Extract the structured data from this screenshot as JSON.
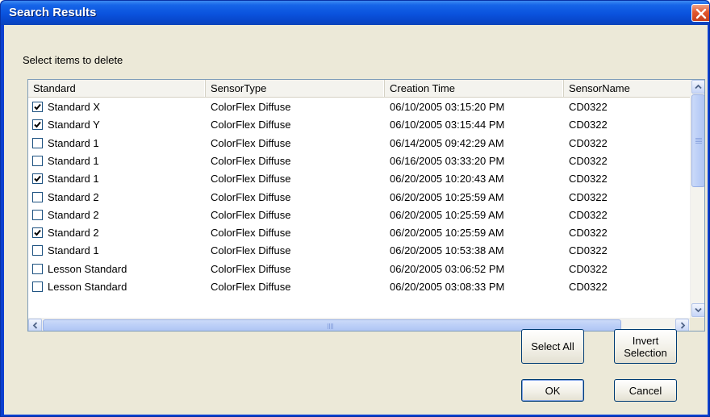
{
  "window": {
    "title": "Search Results"
  },
  "prompt": "Select items to delete",
  "columns": [
    "Standard",
    "SensorType",
    "Creation Time",
    "SensorName"
  ],
  "rows": [
    {
      "checked": true,
      "standard": "Standard X",
      "sensor_type": "ColorFlex Diffuse",
      "creation_time": "06/10/2005 03:15:20 PM",
      "sensor_name": "CD0322"
    },
    {
      "checked": true,
      "standard": "Standard Y",
      "sensor_type": "ColorFlex Diffuse",
      "creation_time": "06/10/2005 03:15:44 PM",
      "sensor_name": "CD0322"
    },
    {
      "checked": false,
      "standard": "Standard 1",
      "sensor_type": "ColorFlex Diffuse",
      "creation_time": "06/14/2005 09:42:29 AM",
      "sensor_name": "CD0322"
    },
    {
      "checked": false,
      "standard": "Standard 1",
      "sensor_type": "ColorFlex Diffuse",
      "creation_time": "06/16/2005 03:33:20 PM",
      "sensor_name": "CD0322"
    },
    {
      "checked": true,
      "standard": "Standard 1",
      "sensor_type": "ColorFlex Diffuse",
      "creation_time": "06/20/2005 10:20:43 AM",
      "sensor_name": "CD0322"
    },
    {
      "checked": false,
      "standard": "Standard 2",
      "sensor_type": "ColorFlex Diffuse",
      "creation_time": "06/20/2005 10:25:59 AM",
      "sensor_name": "CD0322"
    },
    {
      "checked": false,
      "standard": "Standard 2",
      "sensor_type": "ColorFlex Diffuse",
      "creation_time": "06/20/2005 10:25:59 AM",
      "sensor_name": "CD0322"
    },
    {
      "checked": true,
      "standard": "Standard 2",
      "sensor_type": "ColorFlex Diffuse",
      "creation_time": "06/20/2005 10:25:59 AM",
      "sensor_name": "CD0322"
    },
    {
      "checked": false,
      "standard": "Standard 1",
      "sensor_type": "ColorFlex Diffuse",
      "creation_time": "06/20/2005 10:53:38 AM",
      "sensor_name": "CD0322"
    },
    {
      "checked": false,
      "standard": "Lesson Standard",
      "sensor_type": "ColorFlex Diffuse",
      "creation_time": "06/20/2005 03:06:52 PM",
      "sensor_name": "CD0322"
    },
    {
      "checked": false,
      "standard": "Lesson Standard",
      "sensor_type": "ColorFlex Diffuse",
      "creation_time": "06/20/2005 03:08:33 PM",
      "sensor_name": "CD0322"
    }
  ],
  "buttons": {
    "select_all": "Select All",
    "invert_selection": "Invert Selection",
    "ok": "OK",
    "cancel": "Cancel"
  },
  "icons": {
    "close": "close-icon",
    "checkbox": "checkmark-icon",
    "scroll_up": "arrow-up-icon",
    "scroll_down": "arrow-down-icon",
    "scroll_left": "arrow-left-icon",
    "scroll_right": "arrow-right-icon"
  },
  "colors": {
    "titlebar": "#0a52dd",
    "dialog_face": "#ece9d8",
    "close_button": "#e2582f",
    "list_border": "#7f9db9"
  }
}
